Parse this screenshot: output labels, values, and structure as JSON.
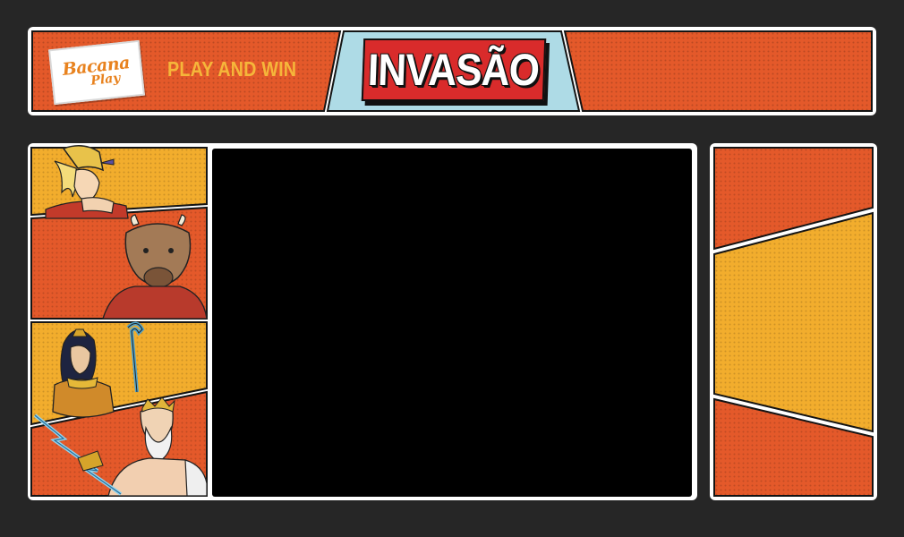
{
  "header": {
    "logo": {
      "line1": "Bacana",
      "line2": "Play"
    },
    "tagline": "PLAY AND WIN",
    "title": "INVASÃO"
  },
  "characters": [
    {
      "name": "warrior-hero",
      "icon": "lion-helmet-warrior"
    },
    {
      "name": "minotaur",
      "icon": "bull-head"
    },
    {
      "name": "egyptian-queen",
      "icon": "egyptian-queen-with-crook"
    },
    {
      "name": "zeus",
      "icon": "bearded-god-with-lightning"
    }
  ],
  "colors": {
    "orange": "#e4592a",
    "yellow": "#f2ad2d",
    "sky": "#aedbe6",
    "red": "#d92b2b",
    "frame": "#ffffff",
    "background": "#262626"
  }
}
